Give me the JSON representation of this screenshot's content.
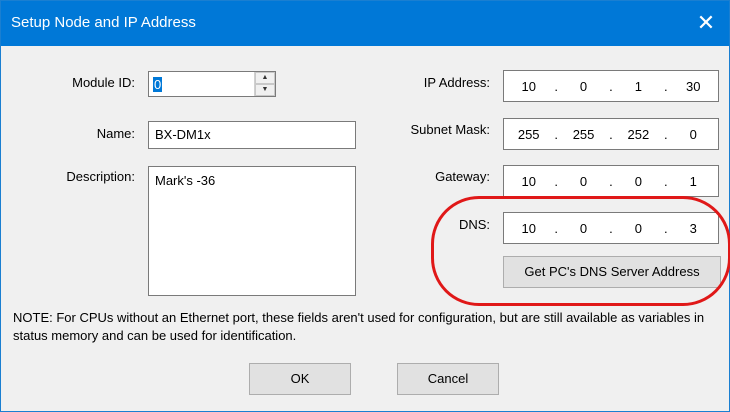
{
  "window": {
    "title": "Setup Node and IP Address",
    "close_glyph": "✕"
  },
  "left": {
    "module_id": {
      "label": "Module ID:",
      "value": "0"
    },
    "name": {
      "label": "Name:",
      "value": "BX-DM1x"
    },
    "description": {
      "label": "Description:",
      "value": "Mark's -36"
    }
  },
  "right": {
    "ip_address": {
      "label": "IP Address:",
      "octets": [
        "10",
        "0",
        "1",
        "30"
      ]
    },
    "subnet_mask": {
      "label": "Subnet Mask:",
      "octets": [
        "255",
        "255",
        "252",
        "0"
      ]
    },
    "gateway": {
      "label": "Gateway:",
      "octets": [
        "10",
        "0",
        "0",
        "1"
      ]
    },
    "dns": {
      "label": "DNS:",
      "octets": [
        "10",
        "0",
        "0",
        "3"
      ]
    },
    "get_dns_button": "Get PC's DNS Server Address"
  },
  "note": "NOTE: For CPUs without an Ethernet port, these fields aren't used for configuration, but are still available as variables in status memory and can be used for identification.",
  "buttons": {
    "ok": "OK",
    "cancel": "Cancel"
  },
  "colors": {
    "titlebar": "#0078d7",
    "highlight": "#e01818"
  }
}
